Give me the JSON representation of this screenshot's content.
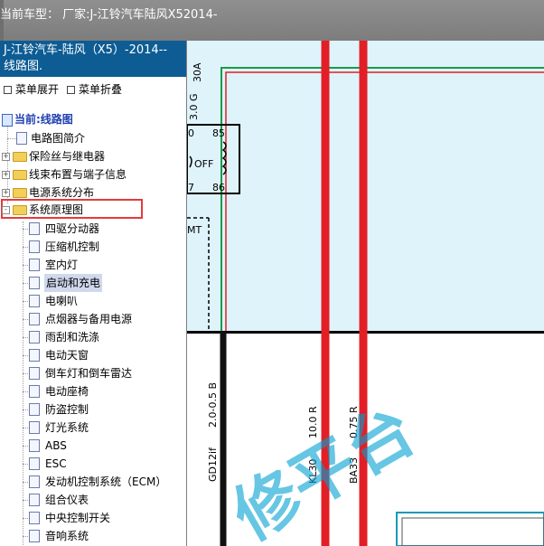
{
  "header": {
    "title": "当前车型：  厂家:J-江铃汽车陆风X52014-"
  },
  "left_panel": {
    "title": "J-江铃汽车-陆风（X5）-2014-- 线路图.",
    "menu_expand": "菜单展开",
    "menu_collapse": "菜单折叠",
    "current": "当前:线路图",
    "items": [
      {
        "label": "电路图简介"
      },
      {
        "label": "保险丝与继电器"
      },
      {
        "label": "线束布置与端子信息"
      },
      {
        "label": "电源系统分布"
      },
      {
        "label": "系统原理图"
      }
    ],
    "sub_items": [
      {
        "label": "四驱分动器"
      },
      {
        "label": "压缩机控制"
      },
      {
        "label": "室内灯"
      },
      {
        "label": "启动和充电"
      },
      {
        "label": "电喇叭"
      },
      {
        "label": "点烟器与备用电源"
      },
      {
        "label": "雨刮和洗涤"
      },
      {
        "label": "电动天窗"
      },
      {
        "label": "倒车灯和倒车雷达"
      },
      {
        "label": "电动座椅"
      },
      {
        "label": "防盗控制"
      },
      {
        "label": "灯光系统"
      },
      {
        "label": "ABS"
      },
      {
        "label": "ESC"
      },
      {
        "label": "发动机控制系统（ECM）"
      },
      {
        "label": "组合仪表"
      },
      {
        "label": "中央控制开关"
      },
      {
        "label": "音响系统"
      }
    ]
  },
  "diagram": {
    "fuse_label": "30A",
    "wire_label_top": "3.0 G",
    "relay_pin_85": "85",
    "relay_pin_86": "86",
    "relay_pin_30": "0",
    "relay_pin_87": "7",
    "relay_state": "OFF",
    "mt_label": "MT",
    "wire_left_spec": "2.0-0.5 B",
    "wire_left_name": "GD12if",
    "wire_mid_spec": "10.0 R",
    "wire_mid_name": "KL30",
    "wire_right_spec": "0.75 R",
    "wire_right_name": "BA33",
    "watermark": "修平台"
  },
  "colors": {
    "header_bg": "#858585",
    "panel_title_bg": "#0d5c94",
    "diagram_bg": "#dff3fb",
    "wire_red": "#e21f26",
    "wire_green": "#1a9a4a",
    "wire_black": "#111111",
    "highlight_box": "#e53b3b"
  }
}
